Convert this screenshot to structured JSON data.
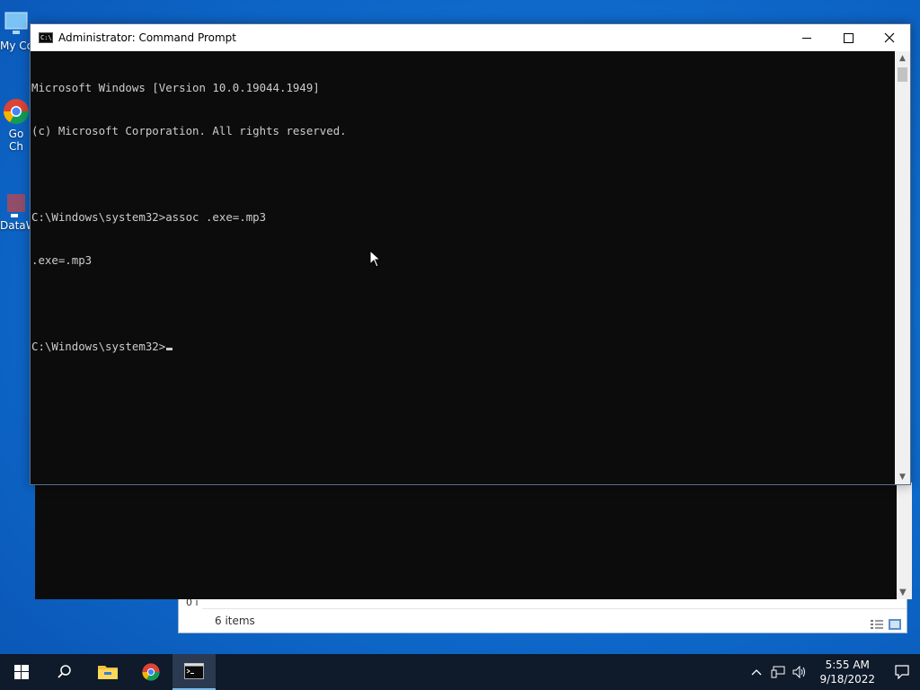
{
  "desktop": {
    "icons": [
      {
        "label": "My Co",
        "icon": "computer-icon"
      },
      {
        "label": "Go\nCh",
        "icon": "chrome-icon"
      },
      {
        "label": "DataW",
        "icon": "app-icon"
      }
    ]
  },
  "explorer": {
    "status_text": "6 items",
    "partial_text": "0 i"
  },
  "cmd": {
    "title": "Administrator: Command Prompt",
    "lines": [
      "Microsoft Windows [Version 10.0.19044.1949]",
      "(c) Microsoft Corporation. All rights reserved.",
      "",
      "C:\\Windows\\system32>assoc .exe=.mp3",
      ".exe=.mp3",
      "",
      "C:\\Windows\\system32>"
    ]
  },
  "taskbar": {
    "items": [
      "start-icon",
      "search-icon",
      "file-explorer-icon",
      "chrome-icon",
      "command-prompt-icon"
    ],
    "clock_time": "5:55 AM",
    "clock_date": "9/18/2022"
  },
  "colors": {
    "console_bg": "#0c0c0c",
    "console_fg": "#cccccc",
    "taskbar_bg": "#0f1a2a",
    "desktop_bg": "#0f6fd0"
  }
}
